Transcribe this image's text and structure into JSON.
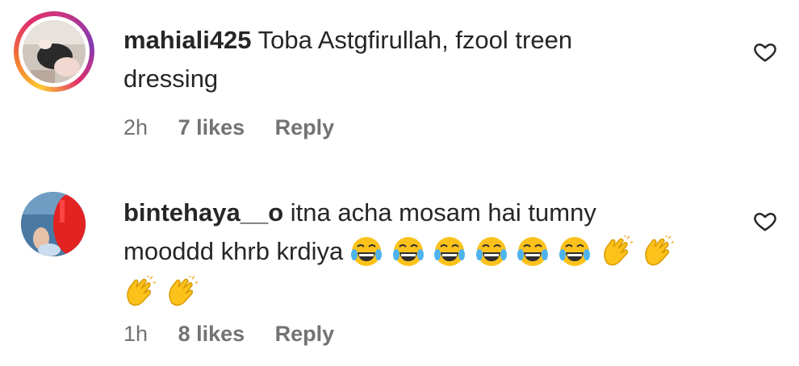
{
  "comments": [
    {
      "username": "mahiali425",
      "text_line1": "Toba Astgfirullah, fzool treen",
      "text_line2": "dressing",
      "time": "2h",
      "likes": "7 likes",
      "reply": "Reply",
      "has_story_ring": true
    },
    {
      "username": "bintehaya__o",
      "text_line1": "itna acha mosam hai tumny",
      "text_line2": "mooddd khrb krdiya",
      "emojis": [
        "face-with-tears-of-joy",
        "face-with-tears-of-joy",
        "face-with-tears-of-joy",
        "face-with-tears-of-joy",
        "face-with-tears-of-joy",
        "face-with-tears-of-joy",
        "clapping-hands",
        "clapping-hands",
        "clapping-hands",
        "clapping-hands"
      ],
      "time": "1h",
      "likes": "8 likes",
      "reply": "Reply",
      "has_story_ring": false
    }
  ],
  "icons": {
    "like": "heart-outline-icon"
  },
  "colors": {
    "text": "#262626",
    "meta": "#737373",
    "ring_start": "#fdc830",
    "ring_end": "#c13584"
  }
}
